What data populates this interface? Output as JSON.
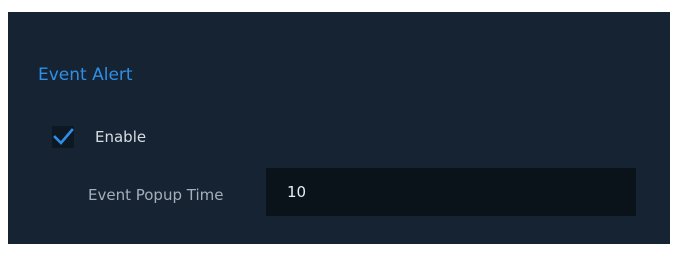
{
  "event_alert": {
    "title": "Event Alert",
    "enable_checkbox": {
      "label": "Enable",
      "checked": true,
      "check_icon": "checkmark-icon"
    },
    "popup_time": {
      "label": "Event Popup Time",
      "value": "10"
    }
  },
  "colors": {
    "panel_background": "#162332",
    "accent": "#2f8fe8",
    "input_background": "#0a121a"
  }
}
